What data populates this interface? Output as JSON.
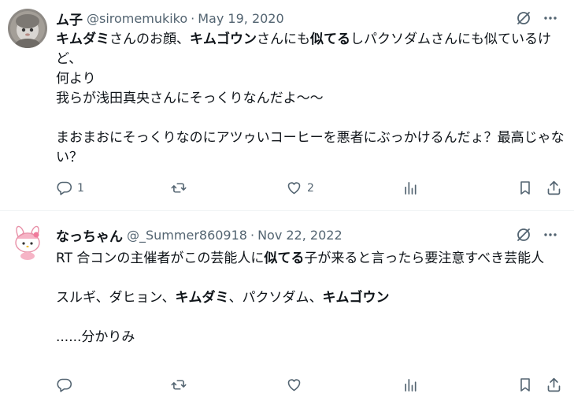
{
  "tweets": [
    {
      "name": "ム子",
      "handle": "@siromemukiko",
      "separator": "·",
      "date": "May 19, 2020",
      "body": [
        {
          "t": "キムダミ",
          "b": true
        },
        {
          "t": "さんのお顔、",
          "b": false
        },
        {
          "t": "キムゴウン",
          "b": true
        },
        {
          "t": "さんにも",
          "b": false
        },
        {
          "t": "似てる",
          "b": true
        },
        {
          "t": "しパクソダムさんにも似ているけど、\n何より\n我らが浅田真央さんにそっくりなんだよ〜〜\n\nまおまおにそっくりなのにアツゥいコーヒーを悪者にぶっかけるんだょ？最高じゃない？",
          "b": false
        }
      ],
      "counts": {
        "reply": "1",
        "retweet": "",
        "like": "2"
      }
    },
    {
      "name": "なっちゃん",
      "handle": "@_Summer860918",
      "separator": "·",
      "date": "Nov 22, 2022",
      "body": [
        {
          "t": "RT 合コンの主催者がこの芸能人に",
          "b": false
        },
        {
          "t": "似てる",
          "b": true
        },
        {
          "t": "子が来ると言ったら要注意すべき芸能人\n\nスルギ、ダヒョン、",
          "b": false
        },
        {
          "t": "キムダミ",
          "b": true
        },
        {
          "t": "、パクソダム、",
          "b": false
        },
        {
          "t": "キムゴウン",
          "b": true
        },
        {
          "t": "\n\n......分かりみ",
          "b": false
        }
      ],
      "counts": {
        "reply": "",
        "retweet": "",
        "like": ""
      }
    }
  ],
  "icons": {
    "grok": "grok-slash-icon",
    "more": "more-dots-icon",
    "reply": "reply-icon",
    "retweet": "retweet-icon",
    "like": "heart-icon",
    "views": "views-chart-icon",
    "bookmark": "bookmark-icon",
    "share": "share-icon"
  },
  "colors": {
    "text": "#0f1419",
    "muted": "#536471",
    "divider": "#eff3f4"
  }
}
